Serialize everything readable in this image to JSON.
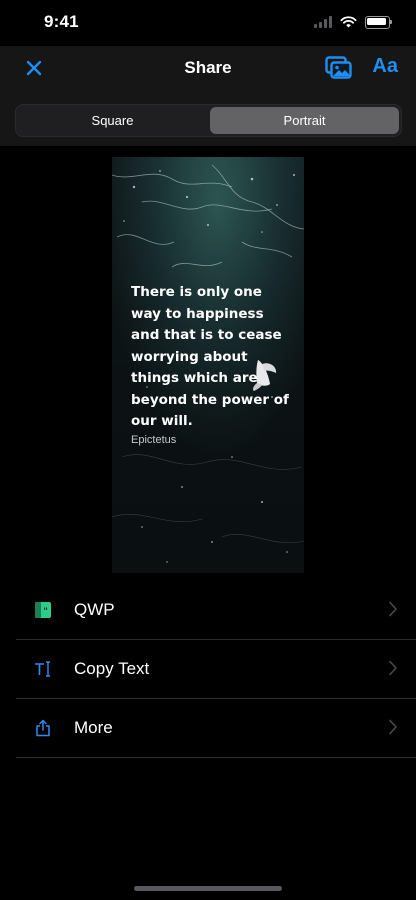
{
  "status": {
    "time": "9:41"
  },
  "nav": {
    "title": "Share",
    "font_button": "Aa",
    "close_icon": "close-icon",
    "gallery_icon": "gallery-icon"
  },
  "segments": {
    "options": [
      "Square",
      "Portrait"
    ],
    "selected": "Portrait"
  },
  "preview": {
    "quote": "There is only one way to happiness and that is to cease worrying about things which are beyond the power of our will.",
    "author": "Epictetus"
  },
  "share_options": [
    {
      "label": "QWP",
      "icon": "qwp-app-icon"
    },
    {
      "label": "Copy Text",
      "icon": "text-cursor-icon"
    },
    {
      "label": "More",
      "icon": "share-icon"
    }
  ],
  "colors": {
    "accent": "#1f8ef1",
    "background": "#000000",
    "nav": "#161617",
    "qwp_green": "#2ecc8a"
  }
}
